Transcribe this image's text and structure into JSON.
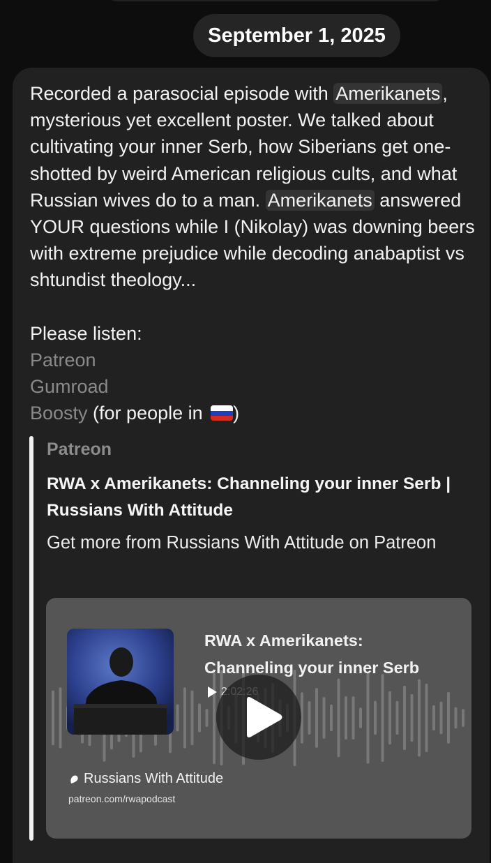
{
  "date_separator": "September 1, 2025",
  "message": {
    "line1_pre": "Recorded a parasocial episode with ",
    "mention1": "Amerikanets",
    "line1_post": ", mysterious yet excellent poster. We talked about cultivating your inner Serb, how Siberians get one-shotted by weird American religious cults, and what Russian wives do to a man. ",
    "mention2": "Amerikanets",
    "line2_post": " answered YOUR questions while I (Nikolay) was downing beers with extreme prejudice while decoding anabaptist vs shtundist theology...",
    "please_listen": "Please listen:",
    "links": [
      "Patreon",
      "Gumroad",
      "Boosty"
    ],
    "boosty_note": " (for people in ",
    "boosty_note_end": ")",
    "flag_colors": [
      "#ffffff",
      "#1d3fbf",
      "#d52b1e"
    ]
  },
  "link_preview": {
    "site": "Patreon",
    "title": "RWA x Amerikanets: Channeling your inner Serb | Russians With Attitude",
    "description": "Get more from Russians With Attitude on Patreon",
    "player": {
      "episode_title": "RWA x Amerikanets: Channeling your inner Serb",
      "duration": "2:02:26",
      "podcast_name": "Russians With Attitude",
      "url": "patreon.com/rwapodcast"
    }
  },
  "colors": {
    "bubble": "#212121",
    "link_text": "#8a8a8a",
    "mention_bg": "#343434",
    "player_bg": "#555555"
  }
}
